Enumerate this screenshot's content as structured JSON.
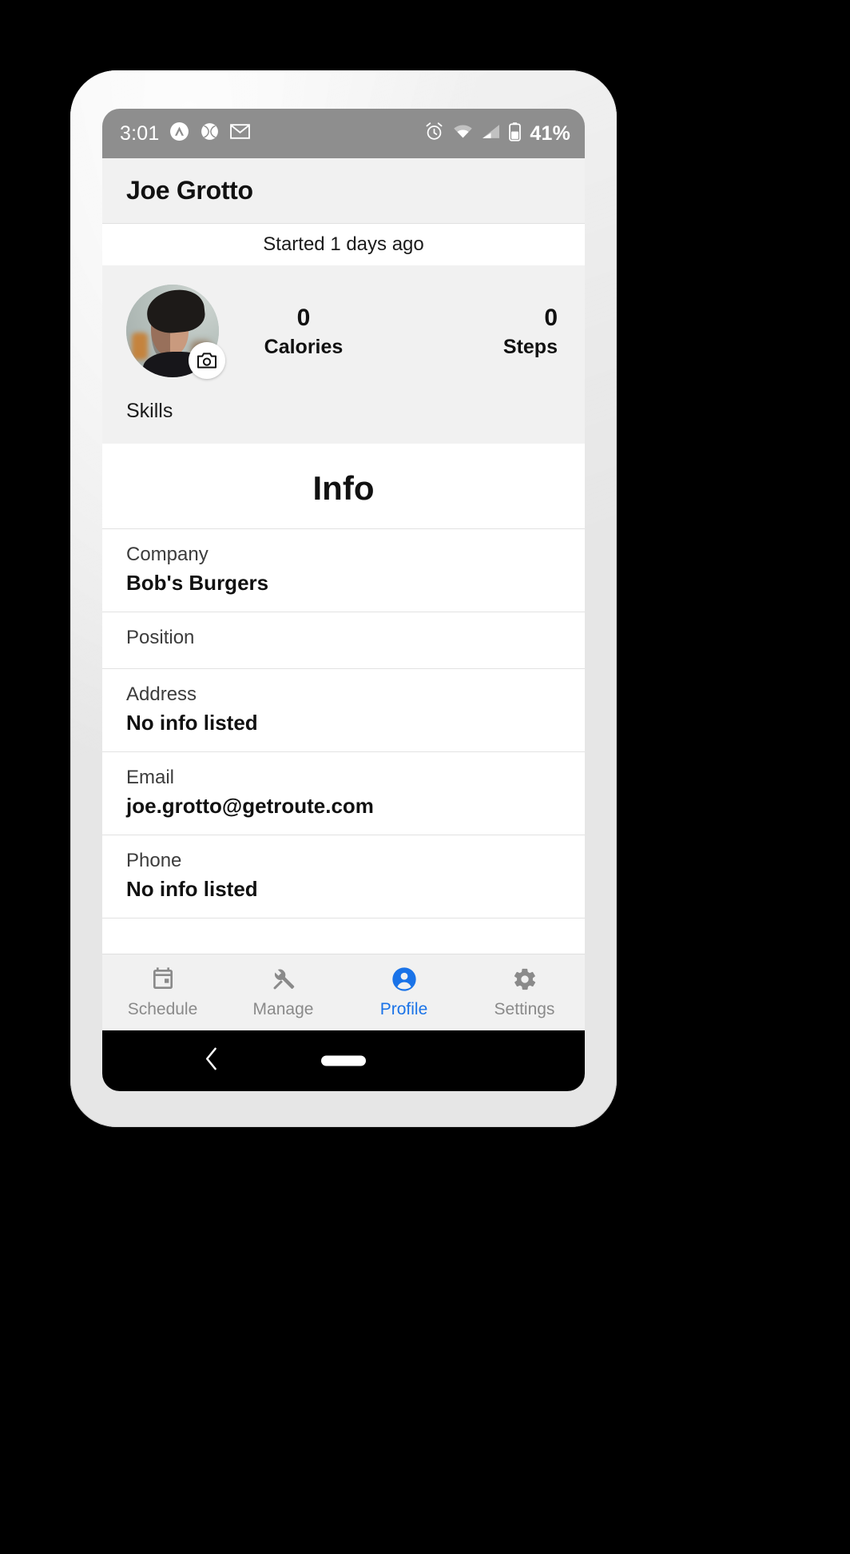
{
  "status_bar": {
    "time": "3:01",
    "battery_percent": "41%",
    "left_icons": [
      "nordvpn-icon",
      "baseball-icon",
      "gmail-icon"
    ],
    "right_icons": [
      "alarm-icon",
      "wifi-icon",
      "cell-signal-icon",
      "battery-icon"
    ],
    "background_color": "#8e8e8e"
  },
  "app_bar": {
    "title": "Joe Grotto"
  },
  "banner": {
    "started_text": "Started 1 days ago"
  },
  "profile": {
    "avatar_alt": "user-profile-photo",
    "camera_button": "camera-icon",
    "stats": [
      {
        "value": "0",
        "label": "Calories"
      },
      {
        "value": "0",
        "label": "Steps"
      }
    ],
    "skills_label": "Skills"
  },
  "info": {
    "title": "Info",
    "fields": [
      {
        "label": "Company",
        "value": "Bob's Burgers"
      },
      {
        "label": "Position",
        "value": ""
      },
      {
        "label": "Address",
        "value": "No info listed"
      },
      {
        "label": "Email",
        "value": "joe.grotto@getroute.com"
      },
      {
        "label": "Phone",
        "value": "No info listed"
      }
    ]
  },
  "bottom_nav": {
    "active_color": "#1a73e8",
    "inactive_color": "#8a8a8a",
    "items": [
      {
        "label": "Schedule",
        "icon": "calendar-icon",
        "active": false
      },
      {
        "label": "Manage",
        "icon": "tools-icon",
        "active": false
      },
      {
        "label": "Profile",
        "icon": "person-icon",
        "active": true
      },
      {
        "label": "Settings",
        "icon": "gear-icon",
        "active": false
      }
    ]
  }
}
